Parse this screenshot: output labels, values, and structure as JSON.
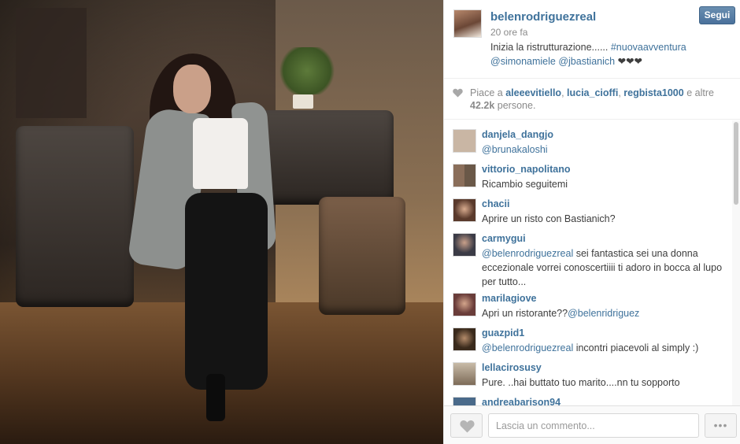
{
  "post": {
    "author": "belenrodriguezreal",
    "time": "20 ore fa",
    "follow_label": "Segui",
    "caption_text": "Inizia la ristrutturazione...... ",
    "caption_hashtag": "#nuovaavventura",
    "caption_mention_1": "@simonamiele",
    "caption_mention_2": "@jbastianich",
    "caption_hearts": "❤❤❤"
  },
  "likes": {
    "prefix": "Piace a",
    "users": [
      "aleeevitiello",
      "lucia_cioffi",
      "regbista1000"
    ],
    "suffix": "e altre",
    "count": "42.2k",
    "count_suffix": "persone."
  },
  "comments": [
    {
      "username": "danjela_dangjo",
      "mention": "@brunakaloshi",
      "text": "",
      "avatar_color": "#c9b6a4"
    },
    {
      "username": "vittorio_napolitano",
      "mention": "",
      "text": "Ricambio seguitemi",
      "avatar_color": "#7f6c5d"
    },
    {
      "username": "chacii",
      "mention": "",
      "text": "Aprire un risto con Bastianich?",
      "avatar_color": "#5a3a2c"
    },
    {
      "username": "carmygui",
      "mention": "@belenrodriguezreal",
      "text": " sei fantastica sei una donna eccezionale vorrei conoscertiiii ti adoro in bocca al lupo per tutto...",
      "avatar_color": "#3b3b46"
    },
    {
      "username": "marilagiove",
      "mention": "",
      "text": "Apri un ristorante??",
      "mention_after": "@belenridriguez",
      "avatar_color": "#6a3d3a"
    },
    {
      "username": "guazpid1",
      "mention": "@belenrodriguezreal",
      "text": " incontri piacevoli al simply :)",
      "avatar_color": "#7b5b3c"
    },
    {
      "username": "lellacirosusy",
      "mention": "",
      "text": "Pure. ..hai buttato tuo marito....nn tu sopporto",
      "avatar_color": "#9a8a78"
    },
    {
      "username": "andreabarison94",
      "mention": "",
      "text": "",
      "avatar_color": "#4a6a8a"
    }
  ],
  "footer": {
    "comment_placeholder": "Lascia un commento...",
    "more_label": "•••"
  }
}
